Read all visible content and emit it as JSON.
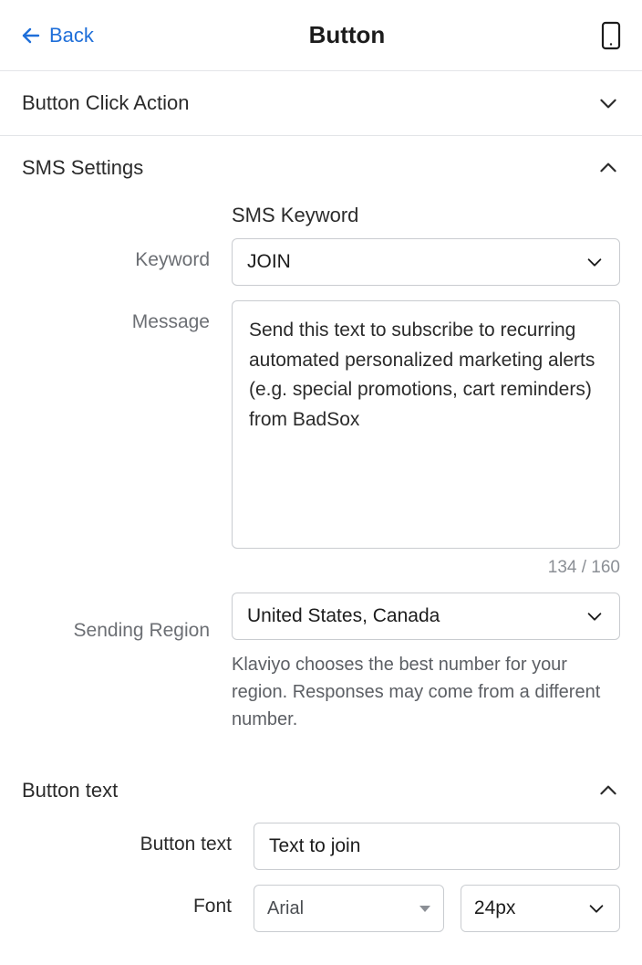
{
  "header": {
    "back_label": "Back",
    "title": "Button"
  },
  "sections": {
    "click_action": {
      "title": "Button Click Action"
    },
    "sms_settings": {
      "title": "SMS Settings",
      "subhead": "SMS Keyword",
      "keyword_label": "Keyword",
      "keyword_value": "JOIN",
      "message_label": "Message",
      "message_value": "Send this text to subscribe to recurring automated personalized marketing alerts (e.g. special promotions, cart reminders) from BadSox",
      "char_count": "134 / 160",
      "region_label": "Sending Region",
      "region_value": "United States, Canada",
      "region_helper": "Klaviyo chooses the best number for your region. Responses may come from a different number."
    },
    "button_text": {
      "title": "Button text",
      "text_label": "Button text",
      "text_value": "Text to join",
      "font_label": "Font",
      "font_value": "Arial",
      "size_value": "24px"
    }
  }
}
